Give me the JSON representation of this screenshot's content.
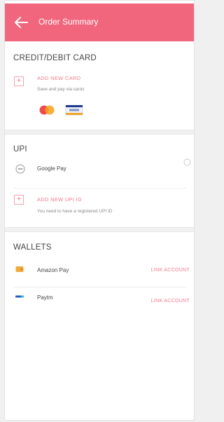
{
  "header": {
    "title": "Order Summary",
    "background": "#f2667d"
  },
  "card_section": {
    "heading": "CREDIT/DEBIT CARD",
    "add_label": "ADD NEW CARD",
    "add_sub": "Save and pay via cards",
    "card_icons": [
      "mastercard-icon",
      "visa-icon"
    ]
  },
  "upi_section": {
    "heading": "UPI",
    "google_pay_label": "Google Pay",
    "add_label": "ADD NEW UPI ID",
    "add_sub": "You need to have a registered UPI ID"
  },
  "wallets_section": {
    "heading": "WALLETS",
    "items": [
      {
        "label": "Amazon Pay",
        "action": "LINK ACCOUNT"
      },
      {
        "label": "Paytm",
        "action": "LINK ACCOUNT"
      }
    ]
  },
  "colors": {
    "accent": "#f2667d",
    "link": "#f27b90"
  }
}
